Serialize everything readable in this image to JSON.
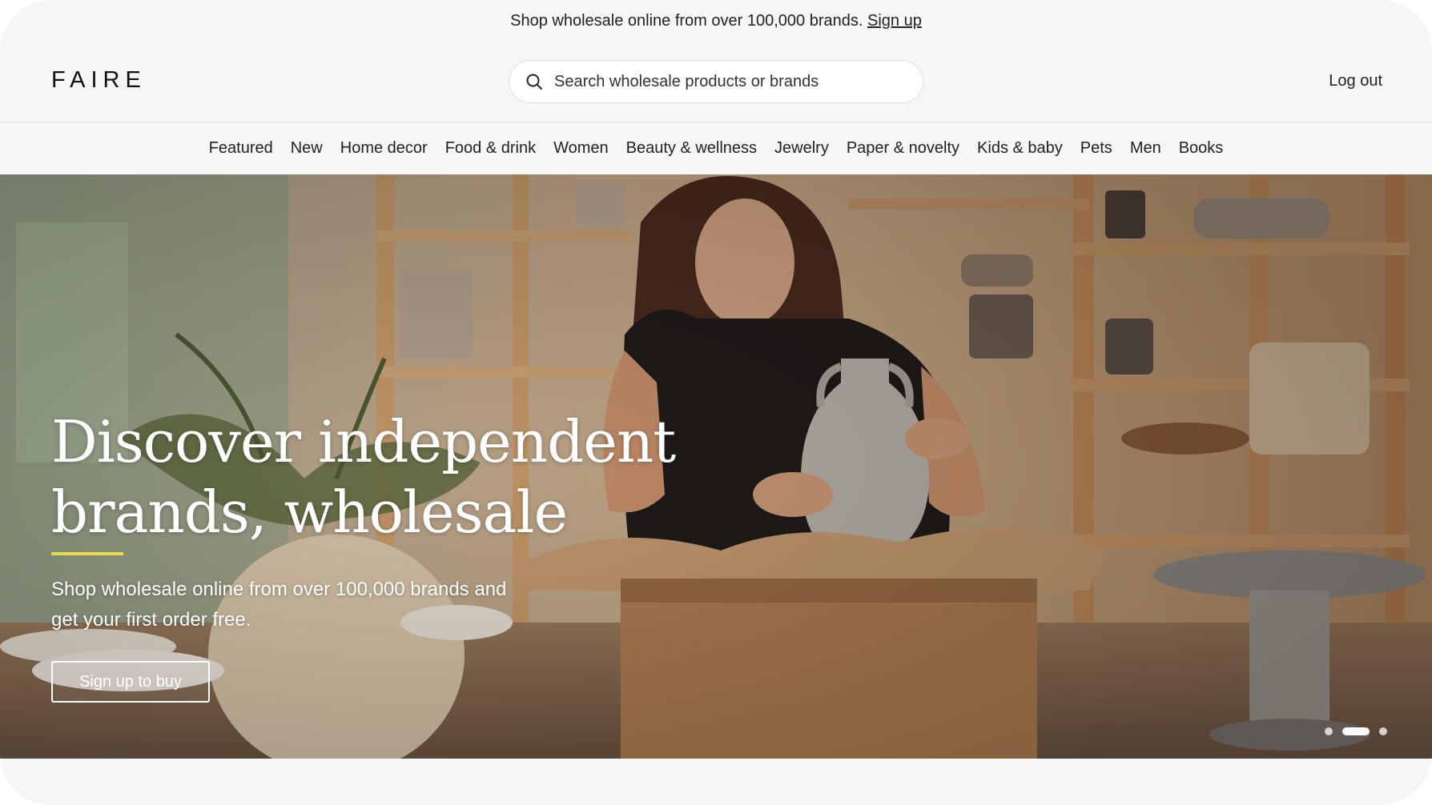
{
  "promo": {
    "text": "Shop wholesale online from over 100,000 brands.",
    "link": "Sign up"
  },
  "header": {
    "logo": "FAIRE",
    "search_placeholder": "Search wholesale products or brands",
    "search_value": "",
    "logout": "Log out"
  },
  "nav": {
    "items": [
      "Featured",
      "New",
      "Home decor",
      "Food & drink",
      "Women",
      "Beauty & wellness",
      "Jewelry",
      "Paper & novelty",
      "Kids & baby",
      "Pets",
      "Men",
      "Books"
    ]
  },
  "hero": {
    "title_line1": "Discover independent",
    "title_line2": "brands, wholesale",
    "subtitle_line1": "Shop wholesale online from over 100,000 brands and",
    "subtitle_line2": "get your first order free.",
    "cta": "Sign up to buy",
    "carousel_total": 3,
    "carousel_active": 2
  },
  "colors": {
    "accent_underline": "#e8d94e",
    "background": "#f6f6f6",
    "text": "#222222"
  },
  "icons": {
    "search": "search-icon"
  }
}
